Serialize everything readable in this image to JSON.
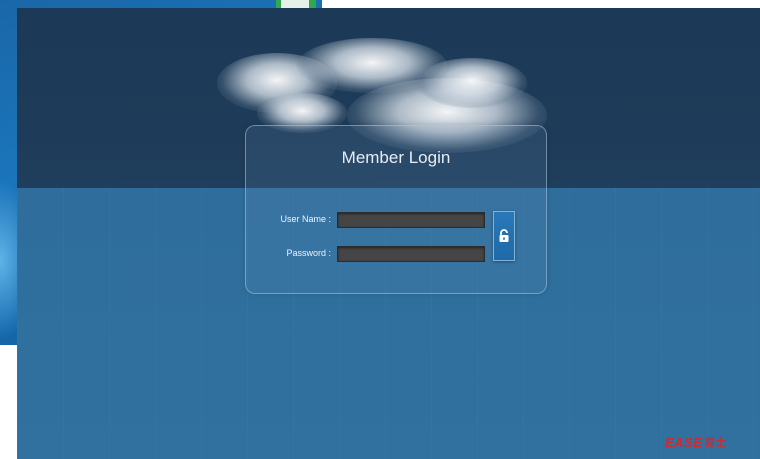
{
  "login": {
    "title": "Member Login",
    "username_label": "User Name :",
    "username_value": "",
    "password_label": "Password :",
    "password_value": "",
    "submit_icon": "unlock-icon"
  },
  "brand": {
    "name": "EASE",
    "suffix": "易士"
  },
  "colors": {
    "sky": "#1e3c59",
    "background": "#31719f",
    "input_bg": "#454545",
    "button": "#2a78b8",
    "brand_red": "#d9262b"
  }
}
